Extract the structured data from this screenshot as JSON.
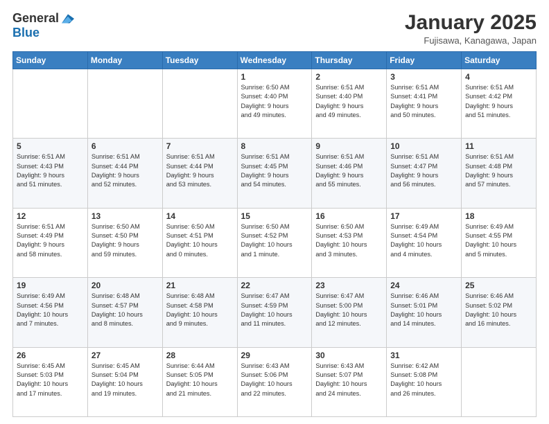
{
  "logo": {
    "general": "General",
    "blue": "Blue"
  },
  "header": {
    "month": "January 2025",
    "location": "Fujisawa, Kanagawa, Japan"
  },
  "days_of_week": [
    "Sunday",
    "Monday",
    "Tuesday",
    "Wednesday",
    "Thursday",
    "Friday",
    "Saturday"
  ],
  "weeks": [
    [
      {
        "day": "",
        "info": ""
      },
      {
        "day": "",
        "info": ""
      },
      {
        "day": "",
        "info": ""
      },
      {
        "day": "1",
        "info": "Sunrise: 6:50 AM\nSunset: 4:40 PM\nDaylight: 9 hours\nand 49 minutes."
      },
      {
        "day": "2",
        "info": "Sunrise: 6:51 AM\nSunset: 4:40 PM\nDaylight: 9 hours\nand 49 minutes."
      },
      {
        "day": "3",
        "info": "Sunrise: 6:51 AM\nSunset: 4:41 PM\nDaylight: 9 hours\nand 50 minutes."
      },
      {
        "day": "4",
        "info": "Sunrise: 6:51 AM\nSunset: 4:42 PM\nDaylight: 9 hours\nand 51 minutes."
      }
    ],
    [
      {
        "day": "5",
        "info": "Sunrise: 6:51 AM\nSunset: 4:43 PM\nDaylight: 9 hours\nand 51 minutes."
      },
      {
        "day": "6",
        "info": "Sunrise: 6:51 AM\nSunset: 4:44 PM\nDaylight: 9 hours\nand 52 minutes."
      },
      {
        "day": "7",
        "info": "Sunrise: 6:51 AM\nSunset: 4:44 PM\nDaylight: 9 hours\nand 53 minutes."
      },
      {
        "day": "8",
        "info": "Sunrise: 6:51 AM\nSunset: 4:45 PM\nDaylight: 9 hours\nand 54 minutes."
      },
      {
        "day": "9",
        "info": "Sunrise: 6:51 AM\nSunset: 4:46 PM\nDaylight: 9 hours\nand 55 minutes."
      },
      {
        "day": "10",
        "info": "Sunrise: 6:51 AM\nSunset: 4:47 PM\nDaylight: 9 hours\nand 56 minutes."
      },
      {
        "day": "11",
        "info": "Sunrise: 6:51 AM\nSunset: 4:48 PM\nDaylight: 9 hours\nand 57 minutes."
      }
    ],
    [
      {
        "day": "12",
        "info": "Sunrise: 6:51 AM\nSunset: 4:49 PM\nDaylight: 9 hours\nand 58 minutes."
      },
      {
        "day": "13",
        "info": "Sunrise: 6:50 AM\nSunset: 4:50 PM\nDaylight: 9 hours\nand 59 minutes."
      },
      {
        "day": "14",
        "info": "Sunrise: 6:50 AM\nSunset: 4:51 PM\nDaylight: 10 hours\nand 0 minutes."
      },
      {
        "day": "15",
        "info": "Sunrise: 6:50 AM\nSunset: 4:52 PM\nDaylight: 10 hours\nand 1 minute."
      },
      {
        "day": "16",
        "info": "Sunrise: 6:50 AM\nSunset: 4:53 PM\nDaylight: 10 hours\nand 3 minutes."
      },
      {
        "day": "17",
        "info": "Sunrise: 6:49 AM\nSunset: 4:54 PM\nDaylight: 10 hours\nand 4 minutes."
      },
      {
        "day": "18",
        "info": "Sunrise: 6:49 AM\nSunset: 4:55 PM\nDaylight: 10 hours\nand 5 minutes."
      }
    ],
    [
      {
        "day": "19",
        "info": "Sunrise: 6:49 AM\nSunset: 4:56 PM\nDaylight: 10 hours\nand 7 minutes."
      },
      {
        "day": "20",
        "info": "Sunrise: 6:48 AM\nSunset: 4:57 PM\nDaylight: 10 hours\nand 8 minutes."
      },
      {
        "day": "21",
        "info": "Sunrise: 6:48 AM\nSunset: 4:58 PM\nDaylight: 10 hours\nand 9 minutes."
      },
      {
        "day": "22",
        "info": "Sunrise: 6:47 AM\nSunset: 4:59 PM\nDaylight: 10 hours\nand 11 minutes."
      },
      {
        "day": "23",
        "info": "Sunrise: 6:47 AM\nSunset: 5:00 PM\nDaylight: 10 hours\nand 12 minutes."
      },
      {
        "day": "24",
        "info": "Sunrise: 6:46 AM\nSunset: 5:01 PM\nDaylight: 10 hours\nand 14 minutes."
      },
      {
        "day": "25",
        "info": "Sunrise: 6:46 AM\nSunset: 5:02 PM\nDaylight: 10 hours\nand 16 minutes."
      }
    ],
    [
      {
        "day": "26",
        "info": "Sunrise: 6:45 AM\nSunset: 5:03 PM\nDaylight: 10 hours\nand 17 minutes."
      },
      {
        "day": "27",
        "info": "Sunrise: 6:45 AM\nSunset: 5:04 PM\nDaylight: 10 hours\nand 19 minutes."
      },
      {
        "day": "28",
        "info": "Sunrise: 6:44 AM\nSunset: 5:05 PM\nDaylight: 10 hours\nand 21 minutes."
      },
      {
        "day": "29",
        "info": "Sunrise: 6:43 AM\nSunset: 5:06 PM\nDaylight: 10 hours\nand 22 minutes."
      },
      {
        "day": "30",
        "info": "Sunrise: 6:43 AM\nSunset: 5:07 PM\nDaylight: 10 hours\nand 24 minutes."
      },
      {
        "day": "31",
        "info": "Sunrise: 6:42 AM\nSunset: 5:08 PM\nDaylight: 10 hours\nand 26 minutes."
      },
      {
        "day": "",
        "info": ""
      }
    ]
  ]
}
